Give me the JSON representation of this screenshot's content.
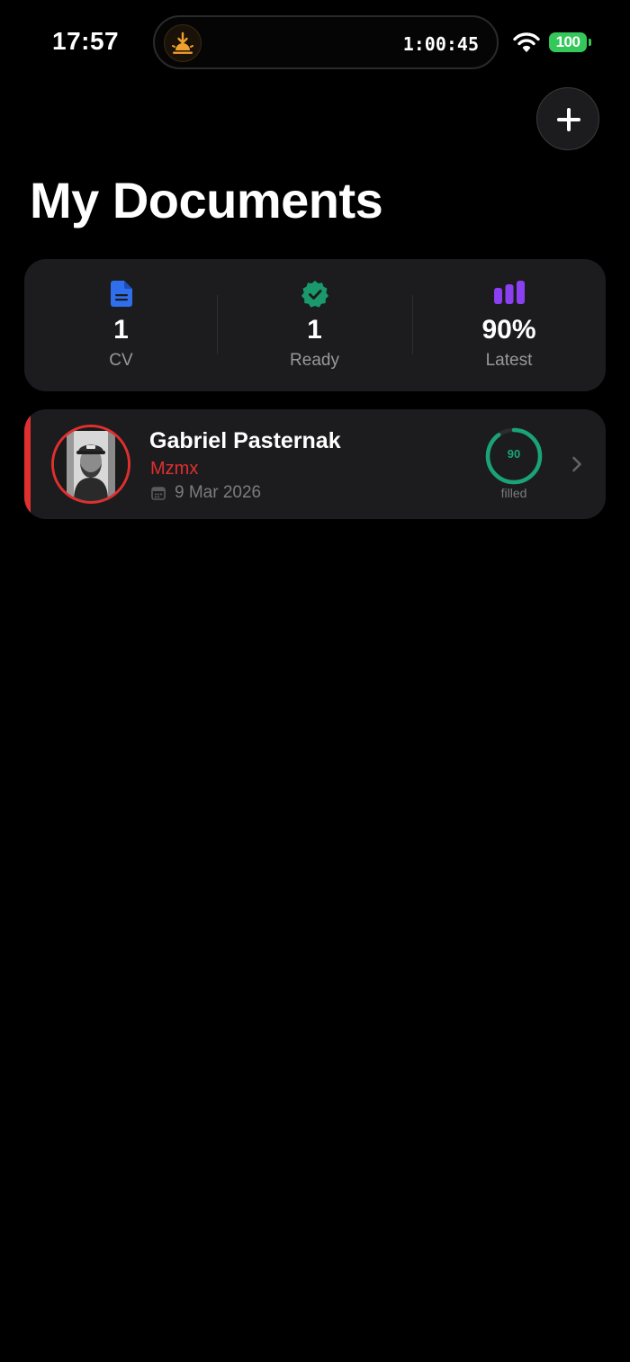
{
  "status_bar": {
    "time": "17:57",
    "live_activity_timer": "1:00:45",
    "battery_level": "100"
  },
  "header": {
    "title": "My Documents"
  },
  "stats": [
    {
      "icon": "document-icon",
      "value": "1",
      "label": "CV",
      "color": "#2f6fee"
    },
    {
      "icon": "verified-badge-icon",
      "value": "1",
      "label": "Ready",
      "color": "#1a9a6c"
    },
    {
      "icon": "bar-chart-icon",
      "value": "90%",
      "label": "Latest",
      "color": "#8a3ff0"
    }
  ],
  "documents": [
    {
      "name": "Gabriel Pasternak",
      "subtitle": "Mzmx",
      "date": "9 Mar 2026",
      "progress": 90,
      "progress_label": "filled",
      "accent_color": "#e02f2f",
      "progress_color": "#1aa377"
    }
  ]
}
